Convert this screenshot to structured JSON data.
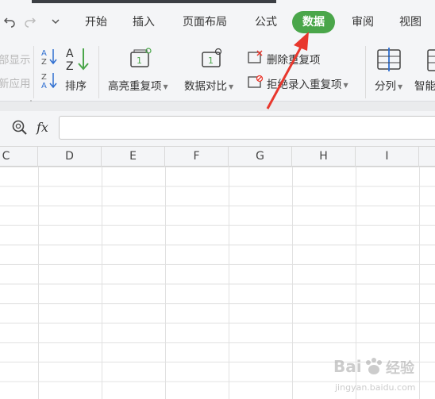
{
  "menubar": {
    "tabs": [
      {
        "label": "开始",
        "active": false
      },
      {
        "label": "插入",
        "active": false
      },
      {
        "label": "页面布局",
        "active": false
      },
      {
        "label": "公式",
        "active": false
      },
      {
        "label": "数据",
        "active": true
      },
      {
        "label": "审阅",
        "active": false
      },
      {
        "label": "视图",
        "active": false
      }
    ],
    "active_color": "#4aa64a"
  },
  "ribbon": {
    "partial_show_label": "部显示",
    "partial_apply_label": "新应用",
    "sort_label": "排序",
    "highlight_dup_label": "高亮重复项",
    "data_compare_label": "数据对比",
    "delete_dup_label": "删除重复项",
    "reject_dup_label": "拒绝录入重复项",
    "split_label": "分列",
    "smart_label": "智能"
  },
  "formula_bar": {
    "fx_label": "fx",
    "value": ""
  },
  "columns": [
    "C",
    "D",
    "E",
    "F",
    "G",
    "H",
    "I"
  ],
  "annotation": {
    "arrow_color": "#e8372d"
  },
  "watermark": {
    "brand": "Bai",
    "brand_cn": "经验",
    "url": "jingyan.baidu.com"
  }
}
